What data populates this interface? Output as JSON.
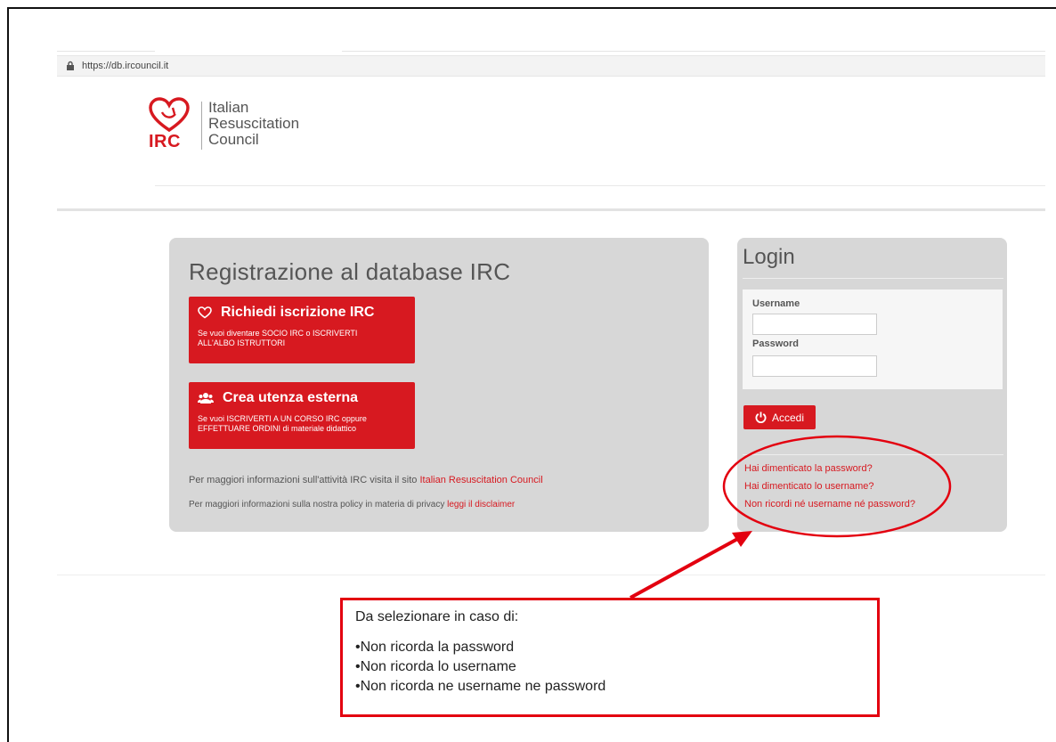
{
  "browser": {
    "url": "https://db.ircouncil.it"
  },
  "logo": {
    "abbr": "IRC",
    "line1": "Italian",
    "line2": "Resuscitation",
    "line3": "Council"
  },
  "registration": {
    "title": "Registrazione al database IRC",
    "card1": {
      "title": "Richiedi iscrizione IRC",
      "desc": "Se vuoi diventare SOCIO IRC o ISCRIVERTI ALL'ALBO ISTRUTTORI"
    },
    "card2": {
      "title": "Crea utenza esterna",
      "desc": "Se vuoi ISCRIVERTI A UN CORSO IRC oppure EFFETTUARE ORDINI di materiale didattico"
    },
    "info1_text": "Per maggiori informazioni sull'attività IRC visita il sito ",
    "info1_link": "Italian Resuscitation Council",
    "info2_text": "Per maggiori informazioni sulla nostra policy in materia di privacy ",
    "info2_link": "leggi il disclaimer"
  },
  "login": {
    "title": "Login",
    "username_label": "Username",
    "username_value": "",
    "password_label": "Password",
    "password_value": "",
    "submit_label": "Accedi",
    "forgot_password": "Hai dimenticato la password?",
    "forgot_username": "Hai dimenticato lo username?",
    "forgot_both": "Non ricordi né username né password?"
  },
  "callout": {
    "heading": "Da selezionare in caso di:",
    "items": [
      "•Non ricorda la password",
      "•Non ricorda lo username",
      "•Non ricorda ne username ne password"
    ]
  },
  "colors": {
    "brand": "#d71920",
    "annotation": "#e3000f",
    "panel": "#d7d7d7"
  },
  "icons": {
    "lock": "lock-icon",
    "heart": "heart-icon",
    "users": "users-icon",
    "power": "power-icon"
  }
}
